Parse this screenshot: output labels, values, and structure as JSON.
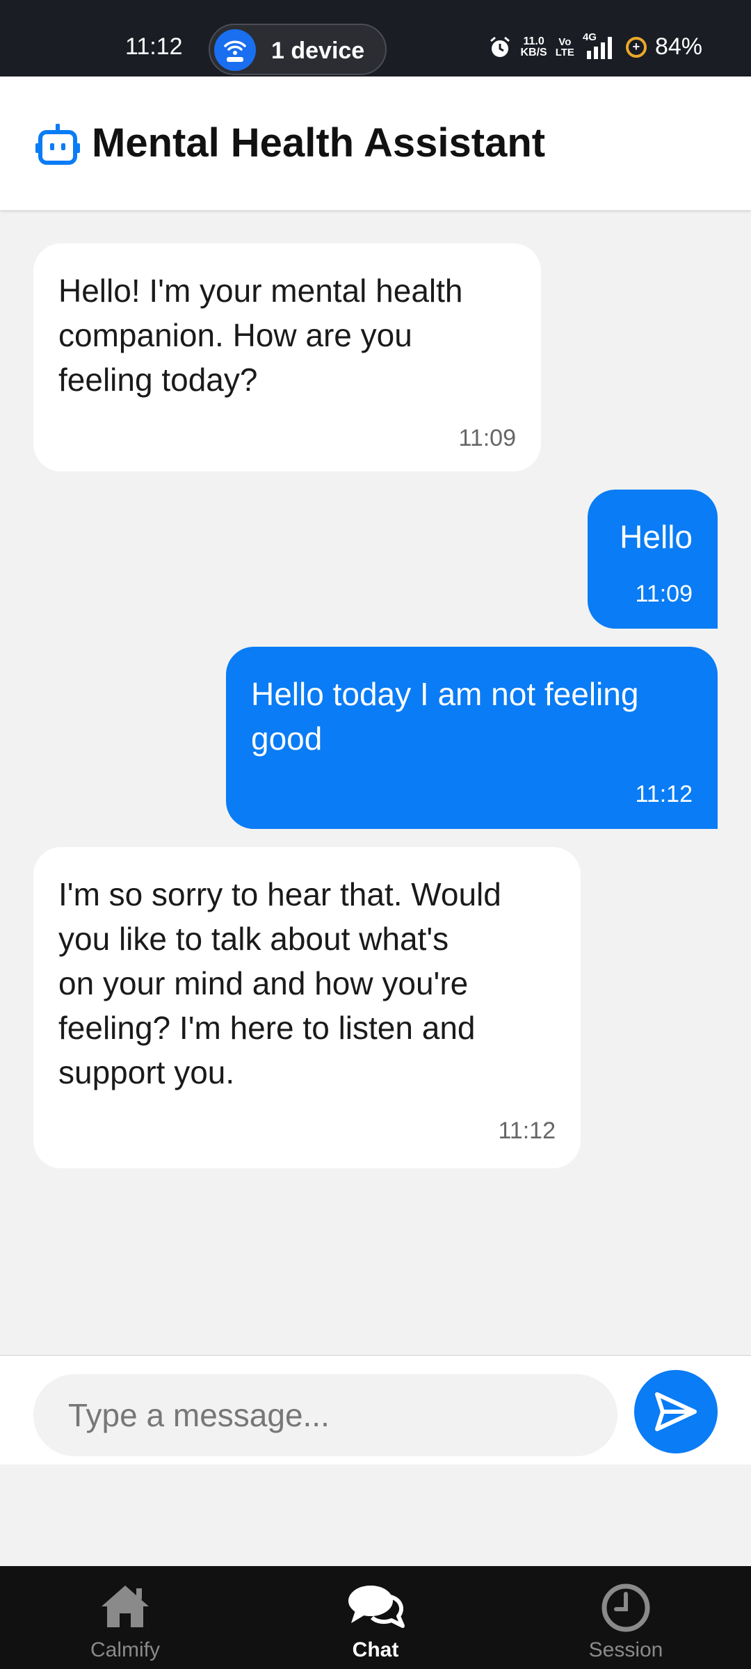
{
  "status_bar": {
    "time": "11:12",
    "hotspot_label": "1 device",
    "net_speed_value": "11.0",
    "net_speed_unit": "KB/S",
    "volte_top": "Vo",
    "volte_bottom": "LTE",
    "network_type": "4G",
    "battery_percent": "84%"
  },
  "header": {
    "title": "Mental Health Assistant",
    "icon": "robot-icon",
    "accent_color": "#0a7cf5"
  },
  "messages": [
    {
      "sender": "bot",
      "lines": [
        "Hello! I'm your mental health",
        "companion. How are you",
        "feeling today?"
      ],
      "time": "11:09"
    },
    {
      "sender": "user",
      "lines": [
        "Hello"
      ],
      "time": "11:09"
    },
    {
      "sender": "user",
      "lines": [
        "Hello today I am not feeling",
        "good"
      ],
      "time": "11:12"
    },
    {
      "sender": "bot",
      "lines": [
        "I'm so sorry to hear that. Would",
        "you like to talk about what's",
        "on your mind and how you're",
        "feeling? I'm here to listen and",
        "support you."
      ],
      "time": "11:12"
    }
  ],
  "composer": {
    "placeholder": "Type a message...",
    "value": "",
    "send_icon": "send-icon"
  },
  "bottom_nav": [
    {
      "label": "Calmify",
      "icon": "home-icon",
      "active": false
    },
    {
      "label": "Chat",
      "icon": "chat-bubbles-icon",
      "active": true
    },
    {
      "label": "Session",
      "icon": "clock-icon",
      "active": false
    }
  ]
}
